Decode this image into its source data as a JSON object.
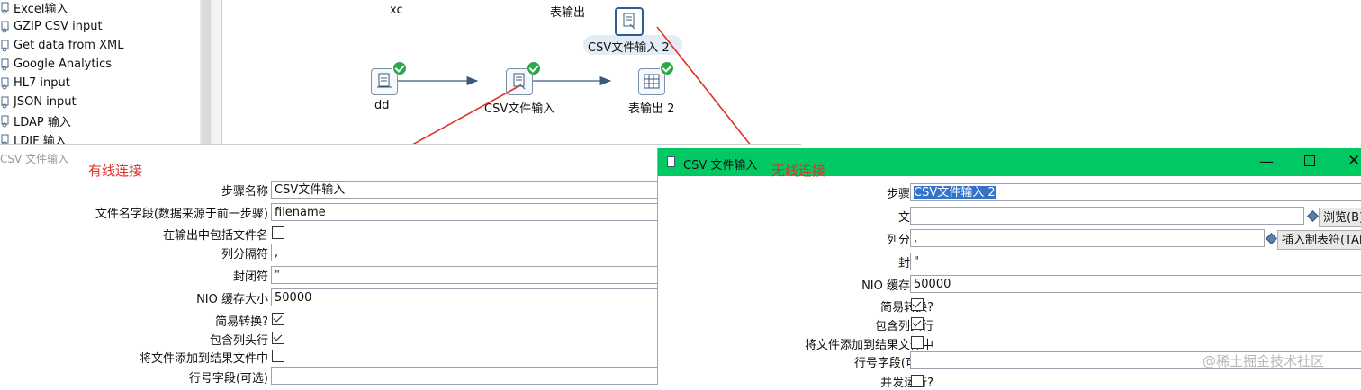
{
  "tree": {
    "items": [
      "Excel输入",
      "GZIP CSV input",
      "Get data from XML",
      "Google Analytics",
      "HL7 input",
      "JSON input",
      "LDAP 输入",
      "LDIF 输入"
    ]
  },
  "canvas": {
    "labels": {
      "xc": "xc",
      "table_output": "表输出"
    },
    "nodes": {
      "dd": "dd",
      "csv_input": "CSV文件输入",
      "table_output_2": "表输出 2",
      "csv_input_2": "CSV文件输入 2"
    }
  },
  "left_dialog": {
    "title": "CSV 文件输入",
    "annotation": "有线连接",
    "fields": {
      "step_name_label": "步骤名称",
      "step_name_value": "CSV文件输入",
      "filename_field_label": "文件名字段(数据来源于前一步骤)",
      "filename_field_value": "filename",
      "include_filename_label": "在输出中包括文件名",
      "delimiter_label": "列分隔符",
      "delimiter_value": ",",
      "enclosure_label": "封闭符",
      "enclosure_value": "\"",
      "nio_label": "NIO 缓存大小",
      "nio_value": "50000",
      "lazy_label": "简易转换?",
      "header_label": "包含列头行",
      "add_result_label": "将文件添加到结果文件中",
      "rownum_label": "行号字段(可选)"
    }
  },
  "right_dialog": {
    "title": "CSV 文件输入",
    "annotation": "无线连接",
    "fields": {
      "step_name_label": "步骤名称",
      "step_name_value": "CSV文件输入 2",
      "filename_label": "文件名",
      "filename_value": "",
      "browse_button": "浏览(B)...",
      "delimiter_label": "列分隔符",
      "delimiter_value": ",",
      "insert_tab_button": "插入制表符(TAB)",
      "enclosure_label": "封闭符",
      "enclosure_value": "\"",
      "nio_label": "NIO 缓存大小",
      "nio_value": "50000",
      "lazy_label": "简易转换?",
      "header_label": "包含列头行",
      "add_result_label": "将文件添加到结果文件中",
      "rownum_label": "行号字段(可选)",
      "parallel_label": "并发运行?"
    }
  },
  "watermark": "@稀土掘金技术社区",
  "colors": {
    "titlebar": "#00c964",
    "annotation": "#e0302a",
    "check": "#2aa84a"
  }
}
